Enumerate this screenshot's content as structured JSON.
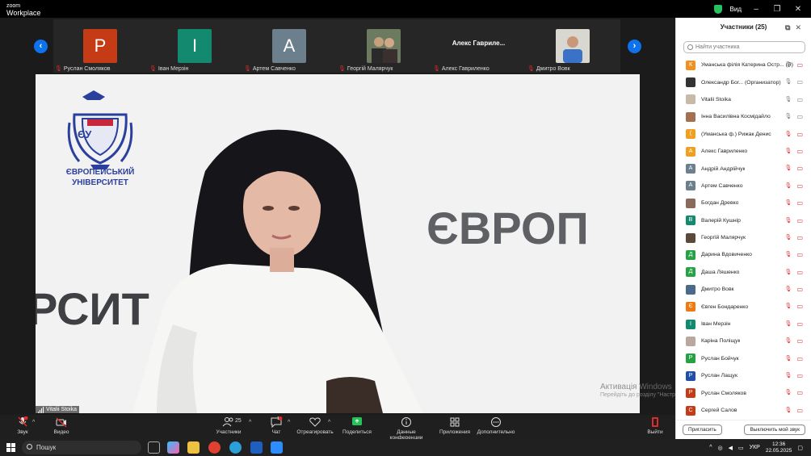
{
  "app": {
    "brand_line1": "zoom",
    "brand_line2": "Workplace",
    "view_label": "Вид"
  },
  "filmstrip": {
    "tiles": [
      {
        "name": "Руслан Смоляков",
        "initial": "P",
        "color": "#c43b16"
      },
      {
        "name": "Іван Мерзін",
        "initial": "I",
        "color": "#138a6f"
      },
      {
        "name": "Артем Савченко",
        "initial": "A",
        "color": "#6b7f8c"
      },
      {
        "name": "Георгій Малярчук",
        "initial": "",
        "color": "#5a4a3a"
      },
      {
        "name": "Алекс Гавриленко",
        "initial": "",
        "color": "#262626",
        "big_name": "Алекс  Гавриле..."
      },
      {
        "name": "Дмитро Вовк",
        "initial": "",
        "color": "#4a6a8a"
      }
    ]
  },
  "main_video": {
    "speaker": "Vitalii Stoika",
    "logo_line1": "ЄВРОПЕЙСЬКИЙ",
    "logo_line2": "УНІВЕРСИТЕТ",
    "logo_badge": "ЄУ",
    "wall_text_right": "ЄВРОП",
    "wall_text_left": "РСИТ"
  },
  "watermark": {
    "line1": "Активація Windows",
    "line2": "Перейдіть до розділу \"Настройки\", щоб активувати Windows."
  },
  "toolbar": {
    "audio": "Звук",
    "video": "Видео",
    "participants": "Участники",
    "participants_count": "25",
    "chat": "Чат",
    "chat_badge": "1",
    "react": "Отреагировать",
    "share": "Поделиться",
    "info": "Данные конференции",
    "apps": "Приложения",
    "more": "Дополнительно",
    "leave": "Выйти"
  },
  "panel": {
    "title": "Участники (25)",
    "search_placeholder": "Найти участника",
    "invite": "Пригласить",
    "mute_all": "Выключить мой звук",
    "participants": [
      {
        "name": "Уманська філія Катерина Остр... (Я)",
        "initial": "К",
        "color": "#f09020",
        "mic": "on",
        "cam": "off"
      },
      {
        "name": "Олександр Бог...  (Организатор)",
        "initial": "",
        "color": "#333333",
        "mic": "on",
        "cam": "on"
      },
      {
        "name": "Vitalii Stoika",
        "initial": "",
        "color": "#c9b9a8",
        "mic": "on",
        "cam": "on"
      },
      {
        "name": "Інна Василівна Космідайло",
        "initial": "",
        "color": "#a57050",
        "mic": "on",
        "cam": "on"
      },
      {
        "name": "(Уманська ф.) Рижак Денис",
        "initial": "(",
        "color": "#f0a020",
        "mic": "off",
        "cam": "off"
      },
      {
        "name": "Алекс Гавриленко",
        "initial": "A",
        "color": "#f0a020",
        "mic": "off",
        "cam": "off"
      },
      {
        "name": "Андрій Андрійчук",
        "initial": "A",
        "color": "#6b7f8c",
        "mic": "off",
        "cam": "off"
      },
      {
        "name": "Артем Савченко",
        "initial": "A",
        "color": "#6b7f8c",
        "mic": "off",
        "cam": "off"
      },
      {
        "name": "Богдан Древко",
        "initial": "",
        "color": "#8a6a5a",
        "mic": "off",
        "cam": "off"
      },
      {
        "name": "Валерій Кушнір",
        "initial": "B",
        "color": "#138a6f",
        "mic": "off",
        "cam": "off"
      },
      {
        "name": "Георгій Малярчук",
        "initial": "",
        "color": "#5a4a3a",
        "mic": "off",
        "cam": "off"
      },
      {
        "name": "Дарина Вдовиченко",
        "initial": "Д",
        "color": "#25a244",
        "mic": "off",
        "cam": "off"
      },
      {
        "name": "Даша Ляшенко",
        "initial": "Д",
        "color": "#25a244",
        "mic": "off",
        "cam": "off"
      },
      {
        "name": "Дмитро Вовк",
        "initial": "",
        "color": "#4a6a8a",
        "mic": "off",
        "cam": "off"
      },
      {
        "name": "Євген Бондаренко",
        "initial": "Є",
        "color": "#f07a10",
        "mic": "off",
        "cam": "off"
      },
      {
        "name": "Іван Мерзін",
        "initial": "I",
        "color": "#138a6f",
        "mic": "off",
        "cam": "off"
      },
      {
        "name": "Каріна Поліщук",
        "initial": "",
        "color": "#b8a8a0",
        "mic": "off",
        "cam": "off"
      },
      {
        "name": "Руслан Бойчук",
        "initial": "P",
        "color": "#25a244",
        "mic": "off",
        "cam": "off"
      },
      {
        "name": "Руслан Лащук",
        "initial": "P",
        "color": "#1f4fa8",
        "mic": "off",
        "cam": "off"
      },
      {
        "name": "Руслан Смоляков",
        "initial": "P",
        "color": "#c43b16",
        "mic": "off",
        "cam": "off"
      },
      {
        "name": "Сергей Салов",
        "initial": "С",
        "color": "#c43b16",
        "mic": "off",
        "cam": "off"
      }
    ]
  },
  "taskbar": {
    "search": "Пошук",
    "lang": "УКР",
    "time": "12:36",
    "date": "22.05.2025"
  }
}
